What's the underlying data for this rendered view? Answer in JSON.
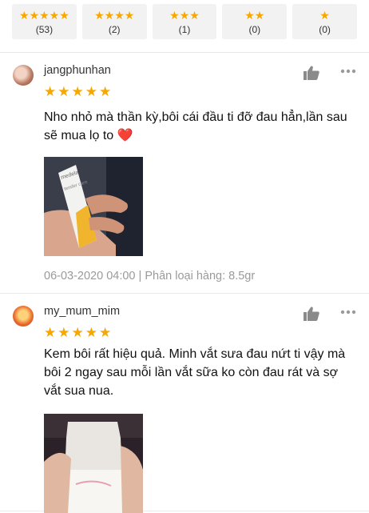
{
  "rating_filters": [
    {
      "stars": "★★★★★",
      "count": "(53)"
    },
    {
      "stars": "★★★★",
      "count": "(2)"
    },
    {
      "stars": "★★★",
      "count": "(1)"
    },
    {
      "stars": "★★",
      "count": "(0)"
    },
    {
      "stars": "★",
      "count": "(0)"
    }
  ],
  "reviews": [
    {
      "username": "jangphunhan",
      "stars": "★★★★★",
      "text": "Nho nhỏ mà thần kỳ,bôi cái đầu ti đỡ đau hẳn,lần sau sẽ mua lọ to ❤️",
      "date": "06-03-2020 04:00",
      "variant": "Phân loại hàng: 8.5gr",
      "separator": " | ",
      "photo_brand": "medela",
      "photo_product": "tender care"
    },
    {
      "username": "my_mum_mim",
      "stars": "★★★★★",
      "text": "Kem bôi rất hiệu quả. Minh vắt sưa đau nứt ti vậy mà bôi 2 ngay sau mỗi lần vắt sữa ko còn đau rát và sợ vắt sua nua."
    }
  ],
  "colors": {
    "star": "#f6a700",
    "chip_bg": "#f2f2f2",
    "meta": "#9a9a9a"
  },
  "icons": [
    "thumbs-up-icon",
    "more-icon"
  ]
}
